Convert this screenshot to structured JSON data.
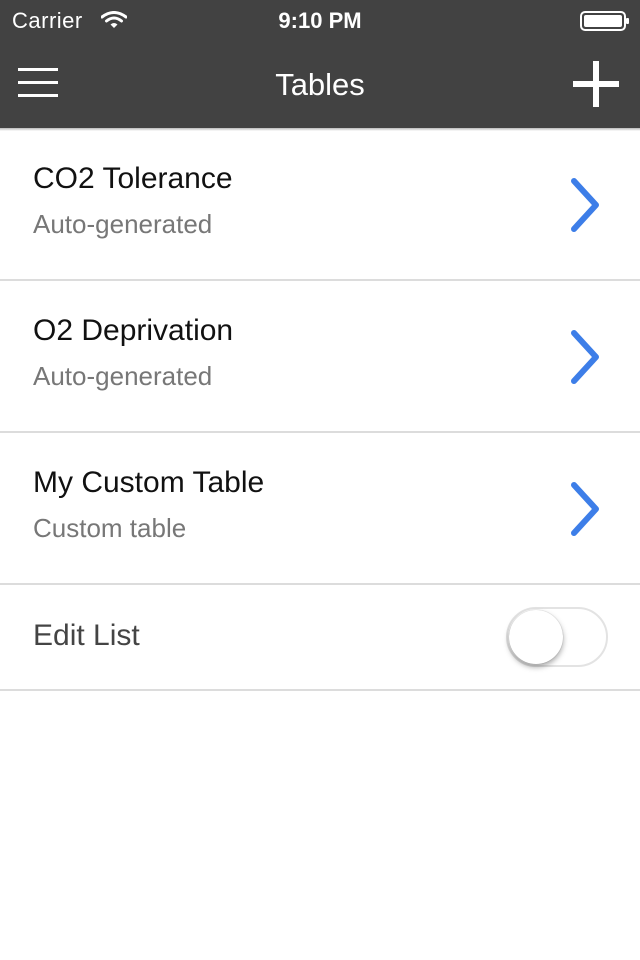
{
  "status_bar": {
    "carrier": "Carrier",
    "time": "9:10 PM",
    "wifi_icon": "wifi-icon",
    "battery_icon": "battery-icon"
  },
  "nav": {
    "title": "Tables",
    "menu_icon": "hamburger-menu-icon",
    "add_icon": "plus-icon"
  },
  "list": {
    "items": [
      {
        "title": "CO2 Tolerance",
        "subtitle": "Auto-generated"
      },
      {
        "title": "O2 Deprivation",
        "subtitle": "Auto-generated"
      },
      {
        "title": "My Custom Table",
        "subtitle": "Custom table"
      }
    ],
    "chevron_icon": "chevron-right-icon"
  },
  "edit": {
    "label": "Edit List",
    "enabled": false
  },
  "colors": {
    "header_bg": "#424242",
    "accent": "#3d7ee8",
    "separator": "#dcdcdc"
  }
}
